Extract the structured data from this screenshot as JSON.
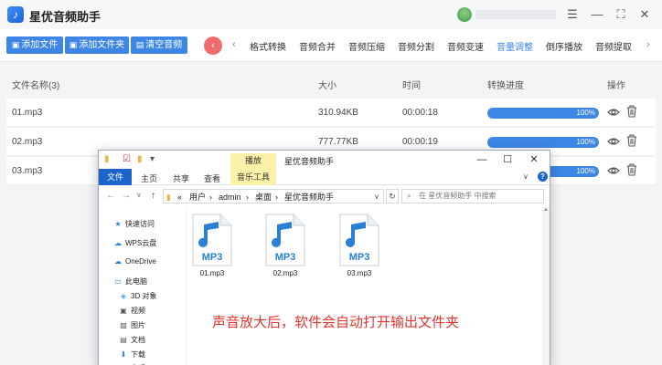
{
  "app": {
    "title": "星优音频助手",
    "logo_glyph": "♪",
    "window_controls": [
      "☰",
      "—",
      "⛶",
      "✕"
    ]
  },
  "toolbar": {
    "buttons": [
      {
        "label": "添加文件",
        "icon": "add-file-icon"
      },
      {
        "label": "添加文件夹",
        "icon": "add-folder-icon"
      },
      {
        "label": "清空音频",
        "icon": "clear-icon"
      }
    ],
    "back_glyph": "‹",
    "prev_glyph": "‹",
    "next_glyph": "›",
    "tabs": [
      "格式转换",
      "音频合并",
      "音频压缩",
      "音频分割",
      "音频变速",
      "音量调整",
      "倒序播放",
      "音频提取"
    ],
    "active_tab": "音量调整"
  },
  "file_table": {
    "headers": {
      "name": "文件名称(3)",
      "size": "大小",
      "time": "时间",
      "progress": "转换进度",
      "actions": "操作"
    },
    "rows": [
      {
        "name": "01.mp3",
        "size": "310.94KB",
        "time": "00:00:18",
        "progress": "100%",
        "progress_value": 1.0
      },
      {
        "name": "02.mp3",
        "size": "777.77KB",
        "time": "00:00:19",
        "progress": "100%",
        "progress_value": 1.0
      },
      {
        "name": "03.mp3",
        "size": "",
        "time": "",
        "progress": "100%",
        "progress_value": 1.0
      }
    ]
  },
  "explorer": {
    "manage_tab": "播放",
    "title": "星优音频助手",
    "controls": [
      "—",
      "☐",
      "✕"
    ],
    "ribbon": {
      "file": "文件",
      "tabs": [
        "主页",
        "共享",
        "查看"
      ],
      "music_tools": "音乐工具",
      "help": "?"
    },
    "nav": {
      "back": "←",
      "forward": "→",
      "dropdown": "∨",
      "up": "↑"
    },
    "breadcrumbs": [
      "«",
      "用户",
      "›",
      "admin",
      "›",
      "桌面",
      "›",
      "星优音频助手"
    ],
    "refresh": "↻",
    "search_placeholder": "在 星优音频助手 中搜索",
    "sidebar": [
      {
        "label": "快速访问",
        "icon": "star-icon",
        "glyph": "★"
      },
      {
        "label": "WPS云盘",
        "icon": "cloud-icon",
        "glyph": "☁"
      },
      {
        "label": "OneDrive",
        "icon": "onedrive-icon",
        "glyph": "☁"
      },
      {
        "label": "此电脑",
        "icon": "computer-icon",
        "glyph": "▭"
      },
      {
        "label": "3D 对象",
        "icon": "cube-icon",
        "glyph": "◈"
      },
      {
        "label": "视频",
        "icon": "video-icon",
        "glyph": "▣"
      },
      {
        "label": "图片",
        "icon": "picture-icon",
        "glyph": "▨"
      },
      {
        "label": "文档",
        "icon": "document-icon",
        "glyph": "▤"
      },
      {
        "label": "下载",
        "icon": "download-icon",
        "glyph": "⬇"
      },
      {
        "label": "音乐",
        "icon": "music-icon",
        "glyph": "♪"
      }
    ],
    "files": [
      {
        "name": "01.mp3",
        "badge": "MP3"
      },
      {
        "name": "02.mp3",
        "badge": "MP3"
      },
      {
        "name": "03.mp3",
        "badge": "MP3"
      }
    ]
  },
  "annotation": "声音放大后，软件会自动打开输出文件夹",
  "colors": {
    "accent": "#3d86e6",
    "note": "#e8322c",
    "back": "#f06b6b",
    "ribbon_file": "#1b64c9"
  }
}
